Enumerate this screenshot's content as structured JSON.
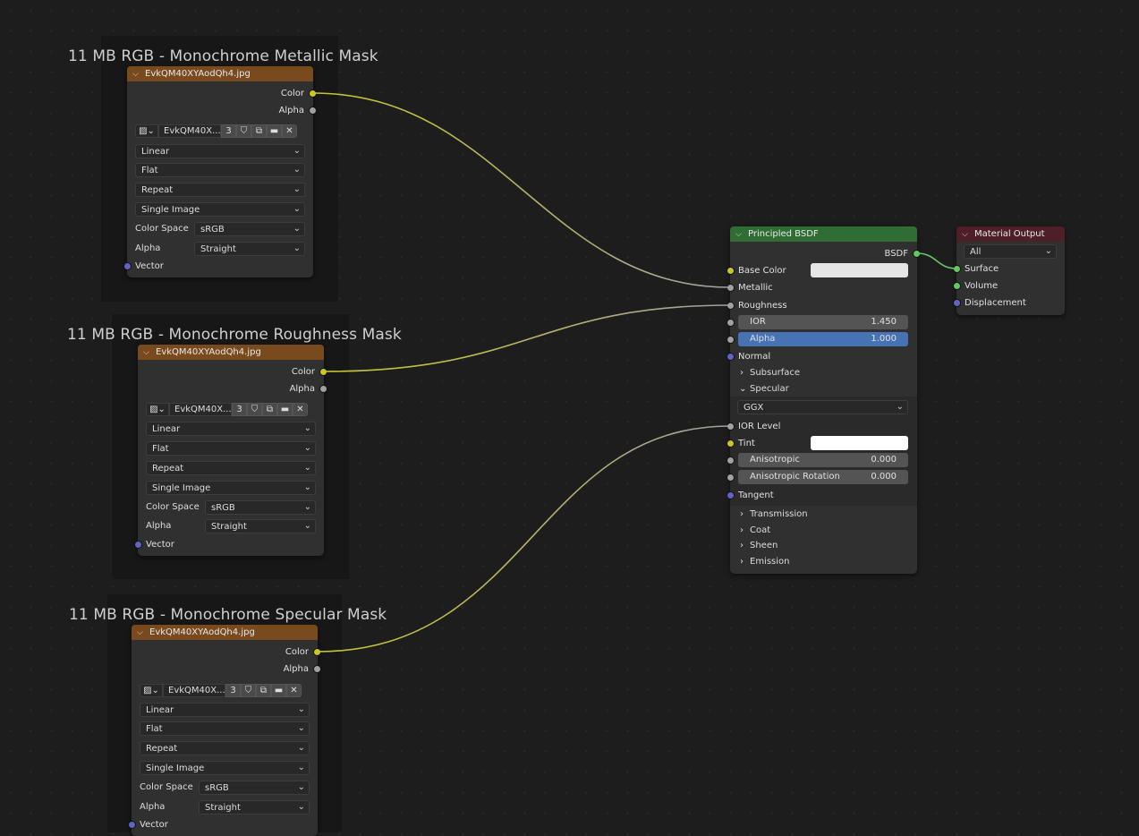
{
  "frames": [
    {
      "label": "11 MB RGB - Monochrome Metallic Mask"
    },
    {
      "label": "11 MB RGB - Monochrome Roughness Mask"
    },
    {
      "label": "11 MB RGB - Monochrome Specular Mask"
    }
  ],
  "image_nodes": [
    {
      "title": "EvkQM40XYAodQh4.jpg",
      "out_color": "Color",
      "out_alpha": "Alpha",
      "image_name": "EvkQM40X...",
      "users": "3",
      "interpolation": "Linear",
      "projection": "Flat",
      "extension": "Repeat",
      "source": "Single Image",
      "color_space_label": "Color Space",
      "color_space": "sRGB",
      "alpha_label": "Alpha",
      "alpha_mode": "Straight",
      "in_vector": "Vector"
    },
    {
      "title": "EvkQM40XYAodQh4.jpg",
      "out_color": "Color",
      "out_alpha": "Alpha",
      "image_name": "EvkQM40X...",
      "users": "3",
      "interpolation": "Linear",
      "projection": "Flat",
      "extension": "Repeat",
      "source": "Single Image",
      "color_space_label": "Color Space",
      "color_space": "sRGB",
      "alpha_label": "Alpha",
      "alpha_mode": "Straight",
      "in_vector": "Vector"
    },
    {
      "title": "EvkQM40XYAodQh4.jpg",
      "out_color": "Color",
      "out_alpha": "Alpha",
      "image_name": "EvkQM40X...",
      "users": "3",
      "interpolation": "Linear",
      "projection": "Flat",
      "extension": "Repeat",
      "source": "Single Image",
      "color_space_label": "Color Space",
      "color_space": "sRGB",
      "alpha_label": "Alpha",
      "alpha_mode": "Straight",
      "in_vector": "Vector"
    }
  ],
  "bsdf": {
    "title": "Principled BSDF",
    "out_bsdf": "BSDF",
    "base_color": "Base Color",
    "metallic": "Metallic",
    "roughness": "Roughness",
    "ior_label": "IOR",
    "ior_value": "1.450",
    "alpha_label": "Alpha",
    "alpha_value": "1.000",
    "normal": "Normal",
    "subsurface": "Subsurface",
    "specular": "Specular",
    "distribution": "GGX",
    "ior_level": "IOR Level",
    "tint": "Tint",
    "anisotropic_label": "Anisotropic",
    "anisotropic_value": "0.000",
    "aniso_rot_label": "Anisotropic Rotation",
    "aniso_rot_value": "0.000",
    "tangent": "Tangent",
    "transmission": "Transmission",
    "coat": "Coat",
    "sheen": "Sheen",
    "emission": "Emission"
  },
  "output": {
    "title": "Material Output",
    "target": "All",
    "surface": "Surface",
    "volume": "Volume",
    "displacement": "Displacement"
  },
  "colors": {
    "image_header": "#7a4a1f",
    "shader_header": "#2f6d34",
    "output_header": "#4f1f27",
    "color_socket": "#c7c729",
    "float_socket": "#a1a1a1",
    "vector_socket": "#6363c7",
    "shader_socket": "#63c763",
    "active_field": "#4772b3"
  }
}
